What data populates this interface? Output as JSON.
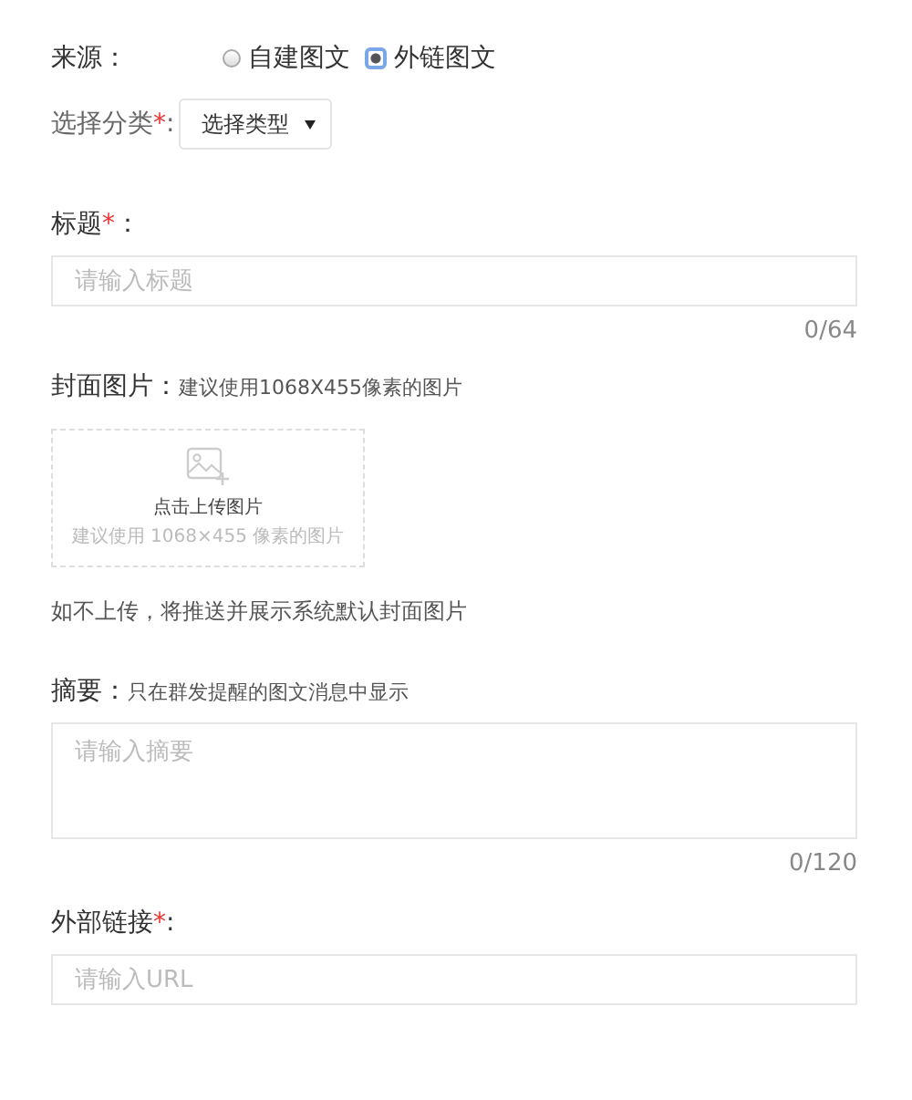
{
  "source": {
    "label": "来源：",
    "options": [
      {
        "label": "自建图文",
        "selected": false
      },
      {
        "label": "外链图文",
        "selected": true
      }
    ]
  },
  "category": {
    "label": "选择分类",
    "mark": "*",
    "colon": ":",
    "value": "选择类型"
  },
  "title": {
    "label": "标题",
    "mark": "*",
    "colon": "：",
    "placeholder": "请输入标题",
    "counter": "0/64"
  },
  "cover": {
    "label": "封面图片：",
    "hint": "建议使用1068X455像素的图片",
    "upload_title": "点击上传图片",
    "upload_hint": "建议使用 1068×455 像素的图片",
    "note": "如不上传，将推送并展示系统默认封面图片"
  },
  "summary": {
    "label": "摘要：",
    "hint": "只在群发提醒的图文消息中显示",
    "placeholder": "请输入摘要",
    "counter": "0/120"
  },
  "link": {
    "label": "外部链接",
    "mark": "*",
    "colon": ":",
    "placeholder": "请输入URL"
  }
}
